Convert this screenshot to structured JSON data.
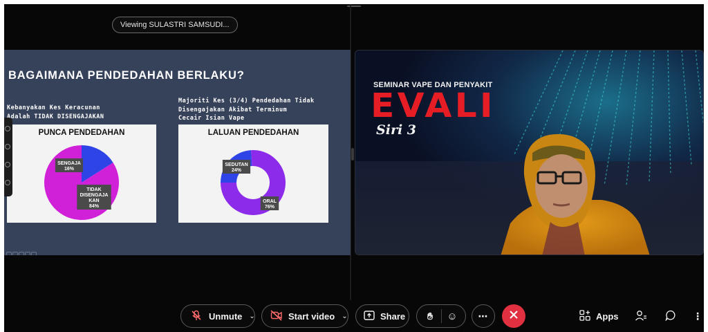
{
  "top": {
    "viewing": "Viewing SULASTRI SAMSUDI..."
  },
  "slide": {
    "title": "BAGAIMANA PENDEDAHAN BERLAKU?",
    "left_caption": [
      "Kebanyakan Kes Keracunan",
      "Adalah TIDAK DISENGAJAKAN"
    ],
    "right_caption": [
      "Majoriti Kes (3/4) Pendedahan Tidak",
      "Disengajakan Akibat Terminum",
      "Cecair Isian Vape"
    ]
  },
  "chart_data": [
    {
      "type": "pie",
      "title": "PUNCA PENDEDAHAN",
      "categories": [
        "SENGAJA",
        "TIDAK DISENGAJA KAN"
      ],
      "values": [
        16,
        84
      ],
      "labels": [
        [
          "SENGAJA",
          "16%"
        ],
        [
          "TIDAK",
          "DISENGAJA",
          "KAN",
          "84%"
        ]
      ],
      "colors": [
        "#2f44e6",
        "#d020d8"
      ]
    },
    {
      "type": "pie",
      "donut": true,
      "title": "LALUAN PENDEDAHAN",
      "categories": [
        "SEDUTAN",
        "ORAL"
      ],
      "values": [
        24,
        76
      ],
      "labels": [
        [
          "SEDUTAN",
          "24%"
        ],
        [
          "ORAL",
          "76%"
        ]
      ],
      "colors": [
        "#2f44e6",
        "#8c2cea"
      ]
    }
  ],
  "video": {
    "subtitle": "SEMINAR VAPE DAN PENYAKIT",
    "brand": "EVALI",
    "series": "Siri 3"
  },
  "toolbar": {
    "unmute": "Unmute",
    "start_video": "Start video",
    "share": "Share",
    "apps": "Apps",
    "leave_color": "#e1303f"
  },
  "icons": [
    "mic-muted-icon",
    "video-off-icon",
    "share-icon",
    "raise-hand-icon",
    "reactions-icon",
    "more-icon",
    "leave-icon",
    "apps-icon",
    "participants-icon",
    "chat-icon",
    "more-vertical-icon"
  ]
}
